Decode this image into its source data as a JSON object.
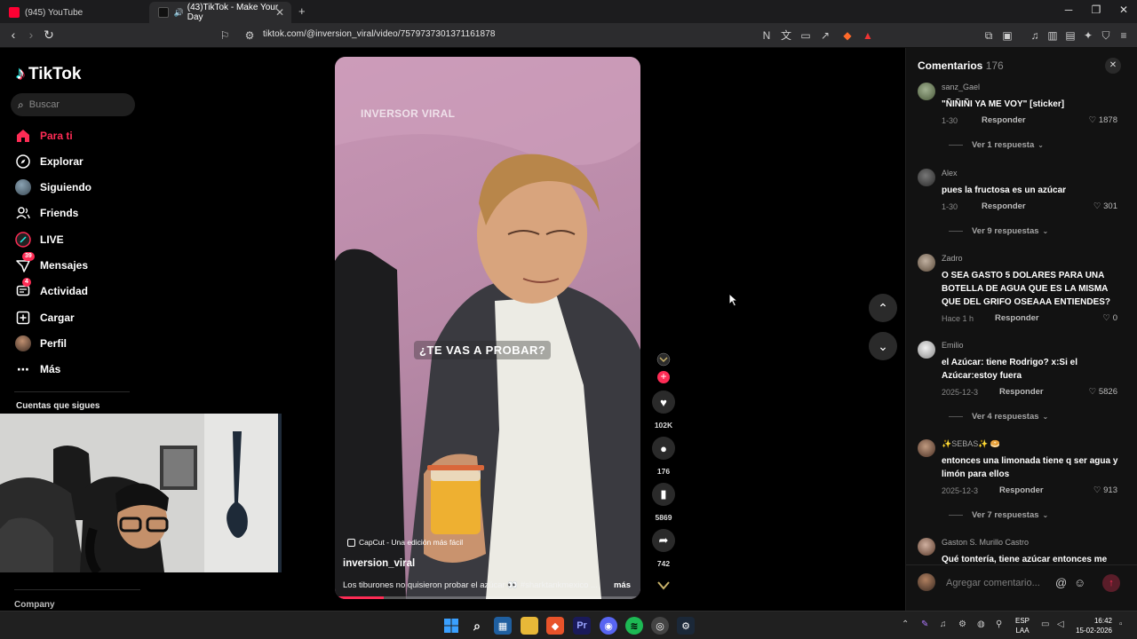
{
  "browser": {
    "tabs": [
      {
        "title": "(945) YouTube",
        "active": false
      },
      {
        "title": "(43)TikTok - Make Your Day",
        "active": true
      }
    ],
    "new_tab": "+",
    "url": "tiktok.com/@inversion_viral/video/7579737301371161878"
  },
  "sidebar": {
    "logo": "TikTok",
    "search_placeholder": "Buscar",
    "items": [
      {
        "label": "Para ti",
        "icon": "home-icon",
        "active": true
      },
      {
        "label": "Explorar",
        "icon": "compass-icon"
      },
      {
        "label": "Siguiendo",
        "icon": "following-avatar"
      },
      {
        "label": "Friends",
        "icon": "friends-icon"
      },
      {
        "label": "LIVE",
        "icon": "live-icon"
      },
      {
        "label": "Mensajes",
        "icon": "messages-icon",
        "badge": "39"
      },
      {
        "label": "Actividad",
        "icon": "activity-icon",
        "badge": "4"
      },
      {
        "label": "Cargar",
        "icon": "upload-icon"
      },
      {
        "label": "Perfil",
        "icon": "profile-avatar"
      },
      {
        "label": "Más",
        "icon": "more-icon"
      }
    ],
    "following_title": "Cuentas que sigues",
    "company": "Company"
  },
  "video": {
    "overlay_brand": "INVERSOR VIRAL",
    "caption": "¿TE VAS A PROBAR?",
    "capcut": "CapCut - Una edición más fácil",
    "author": "inversion_viral",
    "description": "Los tiburones no quisieron probar el azúcar 👀 #sharktankmexico ...",
    "more": "más",
    "progress": 0.16
  },
  "actions": {
    "likes": "102K",
    "comments": "176",
    "saves": "5869",
    "shares": "742"
  },
  "comments_panel": {
    "title": "Comentarios",
    "count": "176",
    "items": [
      {
        "user": "sanz_Gael",
        "text": "\"ÑIÑIÑI YA ME VOY\" [sticker]",
        "date": "1-30",
        "reply": "Responder",
        "likes": "1878",
        "view": "Ver 1 respuesta",
        "avatar_color": "#7a8a6a"
      },
      {
        "user": "Alex",
        "text": "pues la fructosa es un azúcar",
        "date": "1-30",
        "reply": "Responder",
        "likes": "301",
        "view": "Ver 9 respuestas",
        "avatar_color": "#4a4a4a"
      },
      {
        "user": "Zadro",
        "text": "O SEA GASTO 5 DOLARES PARA UNA BOTELLA DE AGUA QUE ES LA MISMA QUE DEL GRIFO OSEAAA ENTIENDES?",
        "date": "Hace 1 h",
        "reply": "Responder",
        "likes": "0",
        "view": "",
        "avatar_color": "#9a8a7a"
      },
      {
        "user": "Emilio",
        "text": "el Azúcar: tiene Rodrigo? x:Si el Azúcar:estoy fuera",
        "date": "2025-12-3",
        "reply": "Responder",
        "likes": "5826",
        "view": "Ver 4 respuestas",
        "avatar_color": "#d8d8d8"
      },
      {
        "user": "✨SEBAS✨ 🥯",
        "text": "entonces una limonada tiene q ser agua y limón para ellos",
        "date": "2025-12-3",
        "reply": "Responder",
        "likes": "913",
        "view": "Ver 7 respuestas",
        "avatar_color": "#8a6a5a"
      },
      {
        "user": "Gaston S. Murillo Castro",
        "text": "Qué tontería, tiene azúcar entonces me",
        "date": "",
        "reply": "",
        "likes": "",
        "view": "",
        "avatar_color": "#a08070"
      }
    ],
    "input_placeholder": "Agregar comentario..."
  },
  "taskbar": {
    "lang": "ESP",
    "lang2": "LAA",
    "time": "16:42",
    "date": "15-02-2026"
  }
}
